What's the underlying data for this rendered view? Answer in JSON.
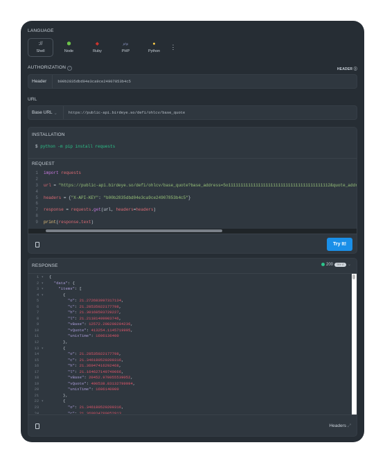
{
  "language": {
    "label": "LANGUAGE",
    "items": [
      {
        "name": "Shell",
        "icon": "shell-icon",
        "glyph": "://",
        "color": "#c9d1d9",
        "active": true
      },
      {
        "name": "Node",
        "icon": "nodejs-icon",
        "glyph": "⬢",
        "color": "#6cc24a"
      },
      {
        "name": "Ruby",
        "icon": "ruby-icon",
        "glyph": "◆",
        "color": "#cc342d"
      },
      {
        "name": "PHP",
        "icon": "php-icon",
        "glyph": "php",
        "color": "#8892bf"
      },
      {
        "name": "Python",
        "icon": "python-icon",
        "glyph": "●",
        "color": "#f7c948"
      }
    ],
    "more": "⋮"
  },
  "authorization": {
    "label": "AUTHORIZATION",
    "help": "?",
    "header_toggle": "HEADER",
    "prefix": "Header",
    "value": "b00b2835dbd04e3ca9ce24907853b4c5"
  },
  "url": {
    "label": "URL",
    "prefix": "Base URL",
    "chevron": "⌄",
    "value": "https://public-api.birdeye.so/defi/ohlcv/base_quote"
  },
  "installation": {
    "label": "INSTALLATION",
    "prompt": "$",
    "command": "python -m pip install requests"
  },
  "request": {
    "label": "REQUEST",
    "try_label": "Try It!",
    "lines": [
      [
        [
          "import ",
          "#c678dd"
        ],
        [
          "requests",
          "#e06c75"
        ]
      ],
      [],
      [
        [
          "url",
          "#e06c75"
        ],
        [
          " = ",
          "#c9d1d9"
        ],
        [
          "\"https://public-api.birdeye.so/defi/ohlcv/base_quote?base_address=So11111111111111111111111111111111111111112&quote_address=EPjFWdd5AufqSSqeM2qN1xzybapC8G4wEGGkZwyTDt1v&type=15m\"",
          "#98c379"
        ]
      ],
      [],
      [
        [
          "headers",
          "#e06c75"
        ],
        [
          " = {",
          "#c9d1d9"
        ],
        [
          "\"X-API-KEY\"",
          "#98c379"
        ],
        [
          ": ",
          "#c9d1d9"
        ],
        [
          "\"b00b2835dbd04e3ca9ce24907853b4c5\"",
          "#98c379"
        ],
        [
          "}",
          "#c9d1d9"
        ]
      ],
      [],
      [
        [
          "response",
          "#e06c75"
        ],
        [
          " = ",
          "#c9d1d9"
        ],
        [
          "requests",
          "#e06c75"
        ],
        [
          ".",
          "#c9d1d9"
        ],
        [
          "get",
          "#c678dd"
        ],
        [
          "(url, ",
          "#c9d1d9"
        ],
        [
          "headers",
          "#e06c75"
        ],
        [
          "=",
          "#c9d1d9"
        ],
        [
          "headers",
          "#e06c75"
        ],
        [
          ")",
          "#c9d1d9"
        ]
      ],
      [],
      [
        [
          "print",
          "#e5c07b"
        ],
        [
          "(",
          "#c9d1d9"
        ],
        [
          "response",
          "#e06c75"
        ],
        [
          ".",
          "#c9d1d9"
        ],
        [
          "text",
          "#e06c75"
        ],
        [
          ")",
          "#c9d1d9"
        ]
      ]
    ]
  },
  "response": {
    "label": "RESPONSE",
    "status_code": "200",
    "status_badge": "TRY IT",
    "status_color": "#2bc48a",
    "footer_headers": "Headers",
    "lines": [
      {
        "t": [
          [
            "{",
            "#c9d1d9"
          ]
        ],
        "fold": true
      },
      {
        "t": [
          [
            "  \"data\"",
            "#a99bd6"
          ],
          [
            ": {",
            "#c9d1d9"
          ]
        ],
        "fold": true
      },
      {
        "t": [
          [
            "    \"items\"",
            "#a99bd6"
          ],
          [
            ": [",
            "#c9d1d9"
          ]
        ],
        "fold": true
      },
      {
        "t": [
          [
            "      {",
            "#c9d1d9"
          ]
        ],
        "fold": true
      },
      {
        "t": [
          [
            "        \"o\"",
            "#a99bd6"
          ],
          [
            ": ",
            "#c9d1d9"
          ],
          [
            "21.272683997317134",
            "#e0566a"
          ],
          [
            ",",
            "#c9d1d9"
          ]
        ]
      },
      {
        "t": [
          [
            "        \"c\"",
            "#a99bd6"
          ],
          [
            ": ",
            "#c9d1d9"
          ],
          [
            "21.28535022177798",
            "#e0566a"
          ],
          [
            ",",
            "#c9d1d9"
          ]
        ]
      },
      {
        "t": [
          [
            "        \"h\"",
            "#a99bd6"
          ],
          [
            ": ",
            "#c9d1d9"
          ],
          [
            "21.30168593729227",
            "#e0566a"
          ],
          [
            ",",
            "#c9d1d9"
          ]
        ]
      },
      {
        "t": [
          [
            "        \"l\"",
            "#a99bd6"
          ],
          [
            ": ",
            "#c9d1d9"
          ],
          [
            "21.21181499903746",
            "#e0566a"
          ],
          [
            ",",
            "#c9d1d9"
          ]
        ]
      },
      {
        "t": [
          [
            "        \"vBase\"",
            "#a99bd6"
          ],
          [
            ": ",
            "#c9d1d9"
          ],
          [
            "12572.298208204236",
            "#e0566a"
          ],
          [
            ",",
            "#c9d1d9"
          ]
        ]
      },
      {
        "t": [
          [
            "        \"vQuote\"",
            "#a99bd6"
          ],
          [
            ": ",
            "#c9d1d9"
          ],
          [
            "413254.1145719995",
            "#e0566a"
          ],
          [
            ",",
            "#c9d1d9"
          ]
        ]
      },
      {
        "t": [
          [
            "        \"unixTime\"",
            "#a99bd6"
          ],
          [
            ": ",
            "#c9d1d9"
          ],
          [
            "1696136400",
            "#e0566a"
          ]
        ]
      },
      {
        "t": [
          [
            "      },",
            "#c9d1d9"
          ]
        ]
      },
      {
        "t": [
          [
            "      {",
            "#c9d1d9"
          ]
        ],
        "fold": true
      },
      {
        "t": [
          [
            "        \"o\"",
            "#a99bd6"
          ],
          [
            ": ",
            "#c9d1d9"
          ],
          [
            "21.28535022177798",
            "#e0566a"
          ],
          [
            ",",
            "#c9d1d9"
          ]
        ]
      },
      {
        "t": [
          [
            "        \"c\"",
            "#a99bd6"
          ],
          [
            ": ",
            "#c9d1d9"
          ],
          [
            "21.346180520200316",
            "#e0566a"
          ],
          [
            ",",
            "#c9d1d9"
          ]
        ]
      },
      {
        "t": [
          [
            "        \"h\"",
            "#a99bd6"
          ],
          [
            ": ",
            "#c9d1d9"
          ],
          [
            "21.36947416292468",
            "#e0566a"
          ],
          [
            ",",
            "#c9d1d9"
          ]
        ]
      },
      {
        "t": [
          [
            "        \"l\"",
            "#a99bd6"
          ],
          [
            ": ",
            "#c9d1d9"
          ],
          [
            "21.164627149749066",
            "#e0566a"
          ],
          [
            ",",
            "#c9d1d9"
          ]
        ]
      },
      {
        "t": [
          [
            "        \"vBase\"",
            "#a99bd6"
          ],
          [
            ": ",
            "#c9d1d9"
          ],
          [
            "20452.970055539052",
            "#e0566a"
          ],
          [
            ",",
            "#c9d1d9"
          ]
        ]
      },
      {
        "t": [
          [
            "        \"vQuote\"",
            "#a99bd6"
          ],
          [
            ": ",
            "#c9d1d9"
          ],
          [
            "490538.83132799994",
            "#e0566a"
          ],
          [
            ",",
            "#c9d1d9"
          ]
        ]
      },
      {
        "t": [
          [
            "        \"unixTime\"",
            "#a99bd6"
          ],
          [
            ": ",
            "#c9d1d9"
          ],
          [
            "1696140000",
            "#e0566a"
          ]
        ]
      },
      {
        "t": [
          [
            "      },",
            "#c9d1d9"
          ]
        ]
      },
      {
        "t": [
          [
            "      {",
            "#c9d1d9"
          ]
        ],
        "fold": true
      },
      {
        "t": [
          [
            "        \"o\"",
            "#a99bd6"
          ],
          [
            ": ",
            "#c9d1d9"
          ],
          [
            "21.346180520200316",
            "#e0566a"
          ],
          [
            ",",
            "#c9d1d9"
          ]
        ]
      },
      {
        "t": [
          [
            "        \"c\"",
            "#a99bd6"
          ],
          [
            ": ",
            "#c9d1d9"
          ],
          [
            "21.369934789052913",
            "#e0566a"
          ],
          [
            ",",
            "#c9d1d9"
          ]
        ]
      }
    ]
  }
}
